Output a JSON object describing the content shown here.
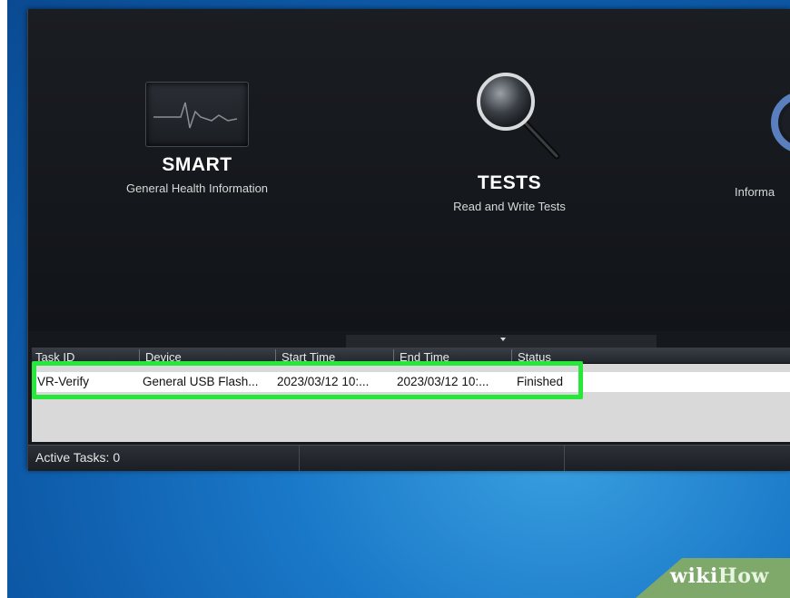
{
  "dashboard": {
    "tiles": [
      {
        "title": "SMART",
        "subtitle": "General Health Information",
        "icon": "heartbeat-monitor-icon"
      },
      {
        "title": "TESTS",
        "subtitle": "Read and Write Tests",
        "icon": "magnifier-icon"
      },
      {
        "title": "",
        "subtitle": "Informa",
        "icon": "gear-icon"
      }
    ]
  },
  "task_table": {
    "columns": [
      "Task ID",
      "Device",
      "Start Time",
      "End Time",
      "Status"
    ],
    "rows": [
      {
        "task_id": "VR-Verify",
        "device": "General USB Flash...",
        "start_time": "2023/03/12 10:...",
        "end_time": "2023/03/12 10:...",
        "status": "Finished"
      }
    ]
  },
  "status_bar": {
    "text": "Active Tasks: 0"
  },
  "watermark": {
    "wiki": "wiki",
    "how": "How"
  },
  "colors": {
    "highlight": "#27e83a",
    "app_bg": "#15181d",
    "desktop": "#1a78c8"
  }
}
